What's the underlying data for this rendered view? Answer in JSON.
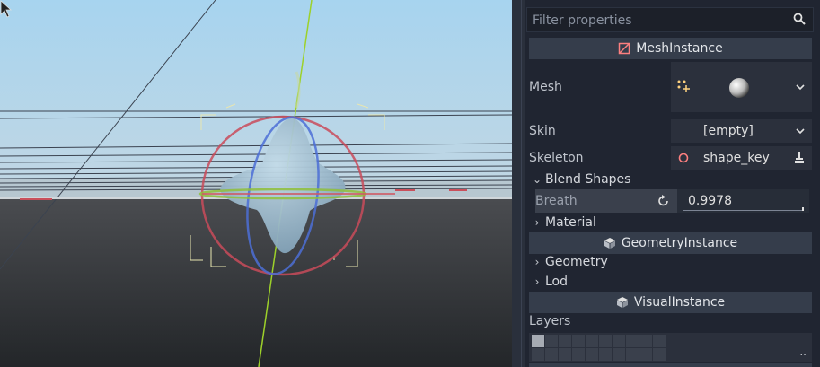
{
  "inspector": {
    "filter_placeholder": "Filter properties",
    "sections": {
      "mesh_instance": "MeshInstance",
      "geometry_instance": "GeometryInstance",
      "visual_instance": "VisualInstance"
    },
    "mesh": {
      "label": "Mesh"
    },
    "skin": {
      "label": "Skin",
      "value": "[empty]"
    },
    "skeleton": {
      "label": "Skeleton",
      "value": "shape_key"
    },
    "blend_shapes": {
      "label": "Blend Shapes",
      "breath": {
        "label": "Breath",
        "value": "0.9978"
      }
    },
    "material": {
      "label": "Material"
    },
    "geometry": {
      "label": "Geometry"
    },
    "lod": {
      "label": "Lod"
    },
    "layers": {
      "label": "Layers",
      "more": ".."
    }
  },
  "colors": {
    "sky": "#a9d4ee",
    "ground": "#2f3236",
    "panel_bg": "#202531",
    "header_bg": "#353d4b",
    "editor_bg": "#2b303c",
    "y_axis": "#9dd12a",
    "gizmo_red": "#c94b5a",
    "gizmo_blue": "#4c6fd6"
  },
  "icons": {
    "search": "search-icon",
    "mesh_instance": "mesh-instance-icon",
    "geometry_instance": "cube-icon",
    "visual_instance": "cube-icon",
    "revert": "revert-icon",
    "dropdown": "chevron-down-icon",
    "skeleton": "skeleton-icon",
    "clear": "clear-icon",
    "mouse": "cursor-icon"
  }
}
